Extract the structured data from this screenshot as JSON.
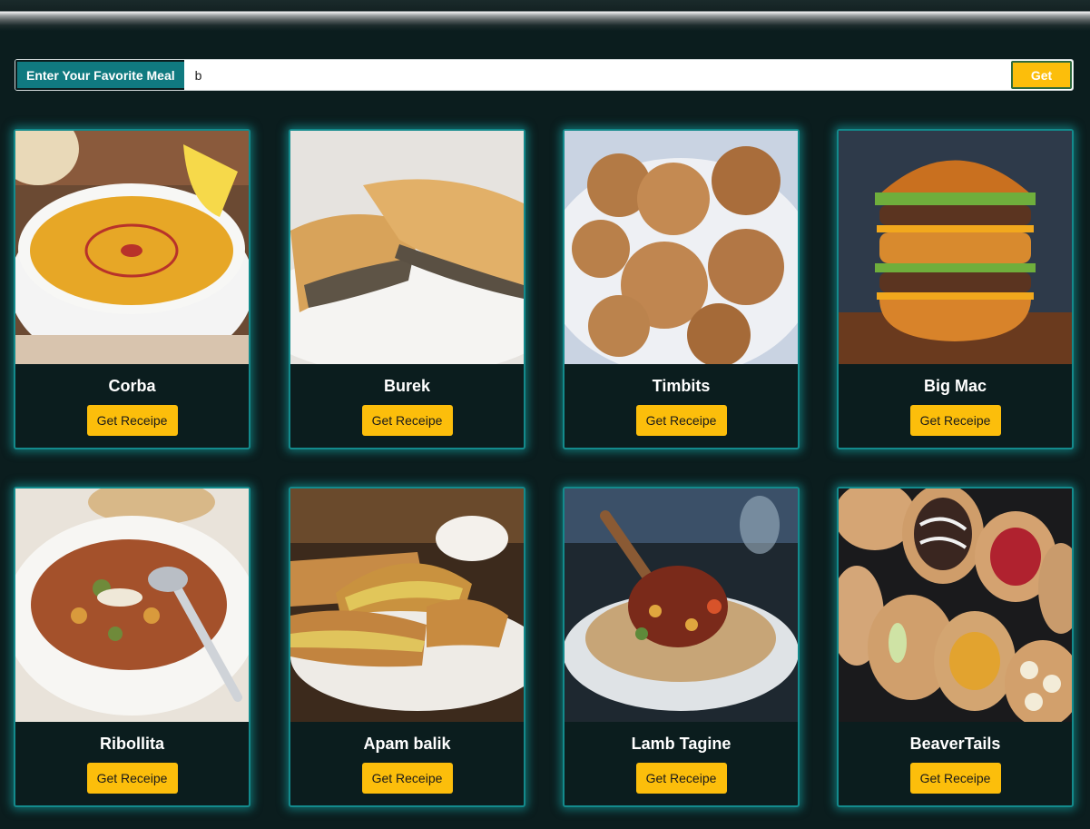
{
  "search": {
    "label": "Enter Your Favorite Meal",
    "value": "b",
    "button_label": "Get"
  },
  "meals": [
    {
      "name": "Corba",
      "button_label": "Get Receipe"
    },
    {
      "name": "Burek",
      "button_label": "Get Receipe"
    },
    {
      "name": "Timbits",
      "button_label": "Get Receipe"
    },
    {
      "name": "Big Mac",
      "button_label": "Get Receipe"
    },
    {
      "name": "Ribollita",
      "button_label": "Get Receipe"
    },
    {
      "name": "Apam balik",
      "button_label": "Get Receipe"
    },
    {
      "name": "Lamb Tagine",
      "button_label": "Get Receipe"
    },
    {
      "name": "BeaverTails",
      "button_label": "Get Receipe"
    }
  ],
  "colors": {
    "background": "#0b1d1e",
    "accent": "#138a8c",
    "button": "#fcbe0b"
  }
}
